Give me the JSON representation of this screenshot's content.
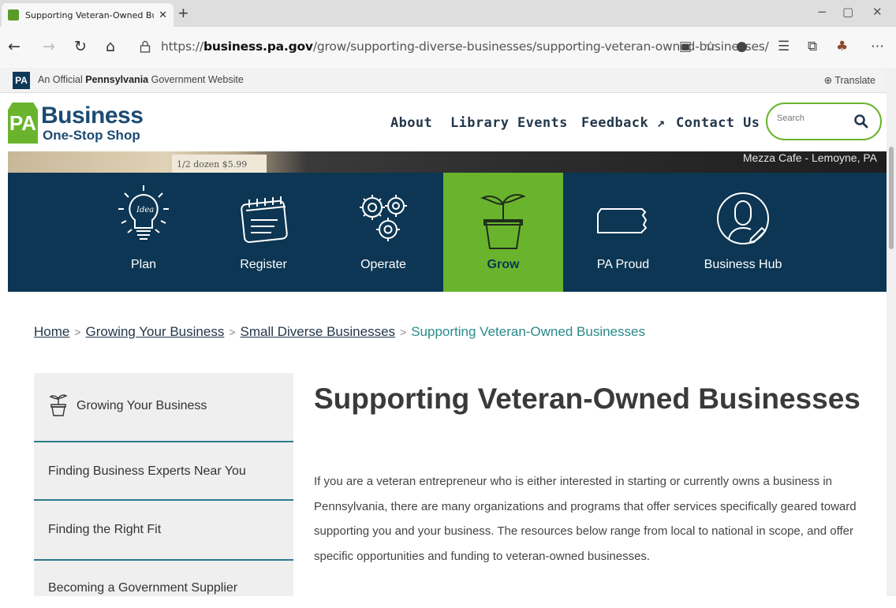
{
  "browser": {
    "tab_title": "Supporting Veteran-Owned Busi",
    "new_tab": "+",
    "url_prefix": "https://",
    "url_domain": "business.pa.gov",
    "url_path": "/grow/supporting-diverse-businesses/supporting-veteran-owned-businesses/",
    "back": "←",
    "forward": "→",
    "refresh": "↻",
    "home": "⌂",
    "minimize": "−",
    "restore": "▢",
    "close": "✕",
    "more": "⋯"
  },
  "official_banner": {
    "badge": "PA",
    "prefix": "An Official ",
    "state": "Pennsylvania",
    "suffix": " Government Website",
    "translate": "Translate"
  },
  "header": {
    "logo_mark": "PA",
    "logo_line1": "Business",
    "logo_line2": "One-Stop Shop",
    "nav": [
      "About",
      "Library",
      "Events",
      "Feedback",
      "Contact Us"
    ],
    "search_placeholder": "Search"
  },
  "hero": {
    "caption": "Mezza Cafe - Lemoyne, PA",
    "price_tag": "1/2 dozen  $5.99"
  },
  "categories": [
    {
      "label": "Plan",
      "icon": "lightbulb-icon"
    },
    {
      "label": "Register",
      "icon": "calendar-icon"
    },
    {
      "label": "Operate",
      "icon": "gears-icon"
    },
    {
      "label": "Grow",
      "icon": "sprout-icon",
      "active": true
    },
    {
      "label": "PA Proud",
      "icon": "pennsylvania-map-icon"
    },
    {
      "label": "Business Hub",
      "icon": "user-icon"
    }
  ],
  "breadcrumb": {
    "items": [
      "Home",
      "Growing Your Business",
      "Small Diverse Businesses"
    ],
    "current": "Supporting Veteran-Owned Businesses"
  },
  "sidemenu": {
    "items": [
      "Growing Your Business",
      "Finding Business Experts Near You",
      "Finding the Right Fit",
      "Becoming a Government Supplier"
    ]
  },
  "main": {
    "title": "Supporting Veteran-Owned Businesses",
    "intro": "If you are a veteran entrepreneur who is either interested in starting or currently owns a business in Pennsylvania, there are many organizations and programs that offer services specifically geared toward supporting you and your business. The resources below range from local to national in scope, and offer specific opportunities and funding to veteran-owned businesses."
  },
  "colors": {
    "navy": "#0c3653",
    "green": "#6ab42d",
    "teal": "#2a7a8a"
  }
}
